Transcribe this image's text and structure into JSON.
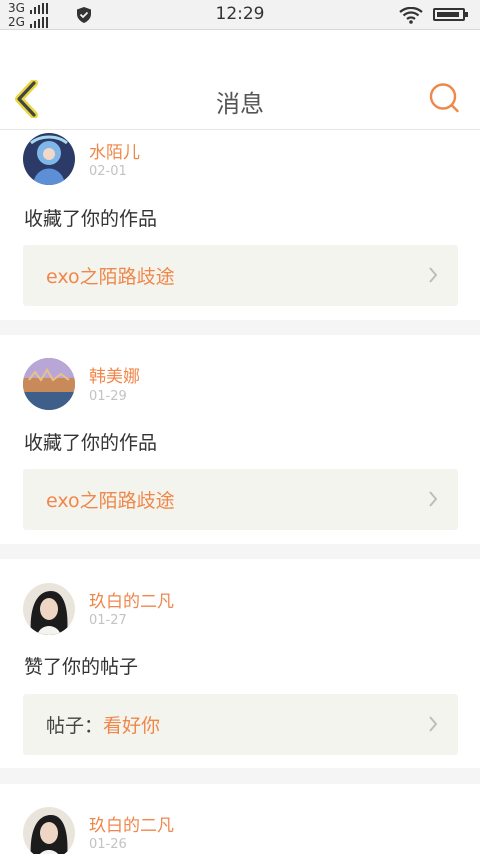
{
  "status_bar": {
    "network_top": "3G",
    "network_bottom": "2G",
    "time": "12:29"
  },
  "header": {
    "title": "消息",
    "back_icon": "back-chevron-icon",
    "search_icon": "search-icon",
    "accent_color": "#f0874a"
  },
  "messages": [
    {
      "username": "水陌儿",
      "date": "02-01",
      "action": "收藏了你的作品",
      "target_prefix": "",
      "target": "exo之陌路歧途"
    },
    {
      "username": "韩美娜",
      "date": "01-29",
      "action": "收藏了你的作品",
      "target_prefix": "",
      "target": "exo之陌路歧途"
    },
    {
      "username": "玖白的二凡",
      "date": "01-27",
      "action": "赞了你的帖子",
      "target_prefix": "帖子：",
      "target": "看好你"
    },
    {
      "username": "玖白的二凡",
      "date": "01-26"
    }
  ]
}
